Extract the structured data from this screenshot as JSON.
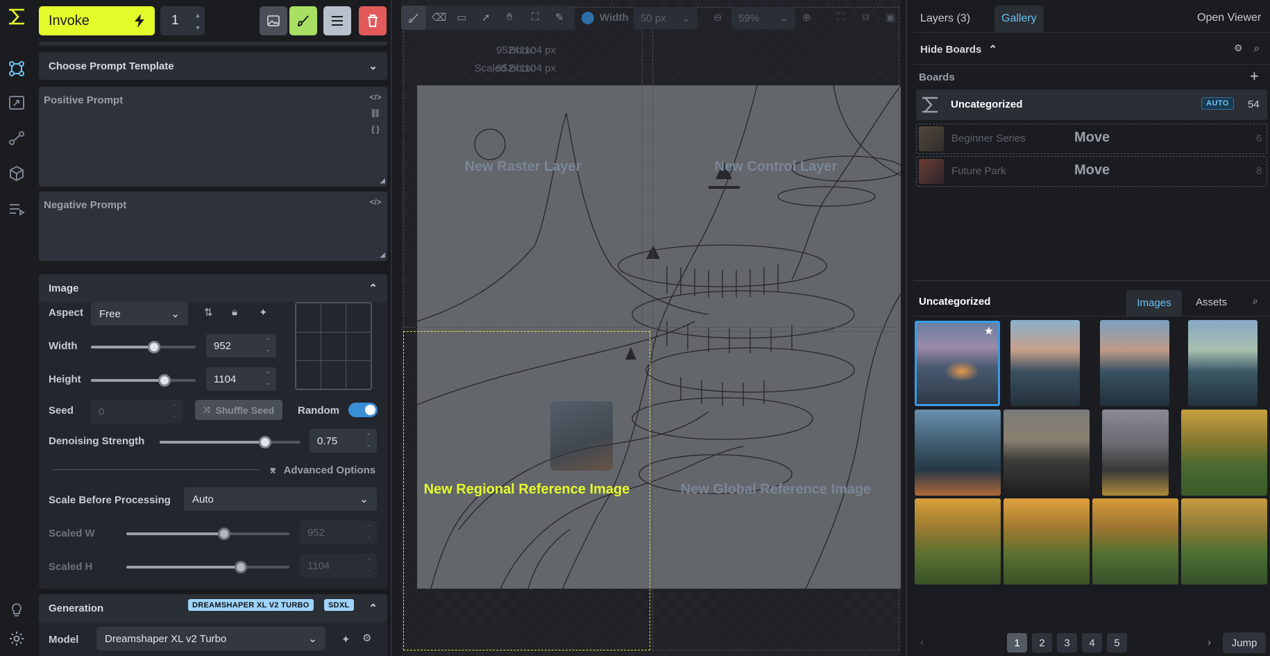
{
  "app": {
    "brand_color": "#e4fc2a",
    "accent_color": "#6bc3f5"
  },
  "rail": {
    "icons": [
      "invoke-logo-icon",
      "canvas-icon",
      "upscale-icon",
      "workflow-icon",
      "models-icon",
      "queue-icon",
      "tips-icon",
      "settings-icon"
    ]
  },
  "topbar": {
    "invoke_label": "Invoke",
    "iterations": "1"
  },
  "left": {
    "prompt_template": "Choose Prompt Template",
    "positive_label": "Positive Prompt",
    "negative_label": "Negative Prompt",
    "image_section": "Image",
    "aspect_label": "Aspect",
    "aspect_value": "Free",
    "width_label": "Width",
    "width_value": "952",
    "width_frac": 0.6,
    "height_label": "Height",
    "height_value": "1104",
    "height_frac": 0.7,
    "seed_label": "Seed",
    "seed_value": "0",
    "shuffle_label": "Shuffle Seed",
    "random_label": "Random",
    "random_on": true,
    "denoise_label": "Denoising Strength",
    "denoise_value": "0.75",
    "denoise_frac": 0.75,
    "advanced_label": "Advanced Options",
    "scale_label": "Scale Before Processing",
    "scale_value": "Auto",
    "scaled_w_label": "Scaled W",
    "scaled_w_value": "952",
    "scaled_w_frac": 0.6,
    "scaled_h_label": "Scaled H",
    "scaled_h_value": "1104",
    "scaled_h_frac": 0.7,
    "generation_label": "Generation",
    "gen_badge_model": "DREAMSHAPER XL V2 TURBO",
    "gen_badge_base": "SDXL",
    "model_label": "Model",
    "model_value": "Dreamshaper XL v2 Turbo"
  },
  "canvas": {
    "width_label": "Width",
    "brush_width": "50 px",
    "zoom": "59%",
    "bbox_label": "Bbox:",
    "bbox_value": "952×1104 px",
    "scaled_bbox_label": "Scaled Bbox:",
    "scaled_bbox_value": "952×1104 px",
    "drop_raster": "New Raster Layer",
    "drop_control": "New Control Layer",
    "drop_regional": "New Regional Reference Image",
    "drop_global": "New Global Reference Image"
  },
  "right": {
    "tab_layers": "Layers (3)",
    "tab_gallery": "Gallery",
    "open_viewer": "Open Viewer",
    "hide_boards": "Hide Boards",
    "boards_label": "Boards",
    "boards": [
      {
        "name": "Uncategorized",
        "badge": "AUTO",
        "count": "54"
      },
      {
        "name": "Beginner Series",
        "action": "Move",
        "count": "6"
      },
      {
        "name": "Future Park",
        "action": "Move",
        "count": "8"
      }
    ],
    "gallery_title": "Uncategorized",
    "tab_images": "Images",
    "tab_assets": "Assets",
    "pages": [
      "1",
      "2",
      "3",
      "4",
      "5"
    ],
    "current_page": "1",
    "jump_label": "Jump"
  }
}
